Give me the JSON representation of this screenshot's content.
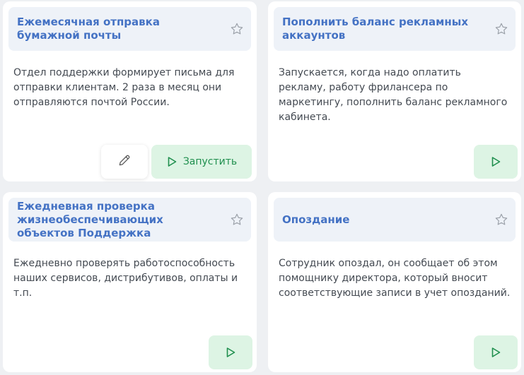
{
  "cards": [
    {
      "title": "Ежемесячная отправка бумажной почты",
      "description": "Отдел поддержки формирует письма для отправки клиентам. 2 раза в месяц они отправляются почтой России.",
      "run_label": "Запустить",
      "has_edit": true
    },
    {
      "title": "Пополнить баланс рекламных аккаунтов",
      "description": "Запускается, когда надо оплатить рекламу, работу фрилансера по маркетингу, пополнить баланс рекламного кабинета.",
      "run_label": "",
      "has_edit": false
    },
    {
      "title": "Ежедневная проверка жизнеобеспечивающих объектов Поддержка",
      "description": "Ежедневно проверять работоспособность наших сервисов, дистрибутивов, оплаты и т.п.",
      "run_label": "",
      "has_edit": false
    },
    {
      "title": "Опоздание",
      "description": "Сотрудник опоздал, он сообщает об этом помощнику директора, который вносит соответствующие записи в учет опозданий.",
      "run_label": "",
      "has_edit": false
    }
  ],
  "icons": {
    "favorite": "star-icon",
    "run": "play-icon",
    "edit": "pencil-icon"
  },
  "colors": {
    "title": "#4472c4",
    "header_bg": "#eef2f8",
    "run_bg": "#ddf4e4",
    "run_fg": "#1f8f4e",
    "text": "#444a52"
  }
}
